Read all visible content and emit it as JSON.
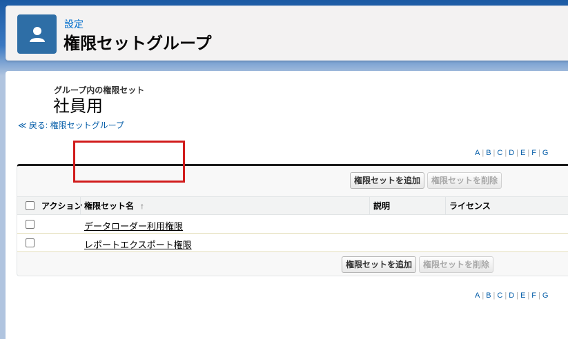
{
  "header": {
    "breadcrumb": "設定",
    "title": "権限セットグループ",
    "icon": "user-icon"
  },
  "page": {
    "subtitle_small": "グループ内の権限セット",
    "subtitle_big": "社員用",
    "back_link": "≪ 戻る: 権限セットグループ"
  },
  "alpha_index": [
    "A",
    "B",
    "C",
    "D",
    "E",
    "F",
    "G"
  ],
  "buttons": {
    "add": "権限セットを追加",
    "remove": "権限セットを削除"
  },
  "table": {
    "columns": {
      "action": "アクション",
      "name": "権限セット名",
      "sort_indicator": "↑",
      "description": "説明",
      "license": "ライセンス"
    },
    "rows": [
      {
        "name": "データローダー利用権限",
        "description": "",
        "license": ""
      },
      {
        "name": "レポートエクスポート権限",
        "description": "",
        "license": ""
      }
    ]
  },
  "colors": {
    "accent": "#006dcc",
    "icon_bg": "#2e6ea6",
    "highlight": "#d11c1c"
  }
}
